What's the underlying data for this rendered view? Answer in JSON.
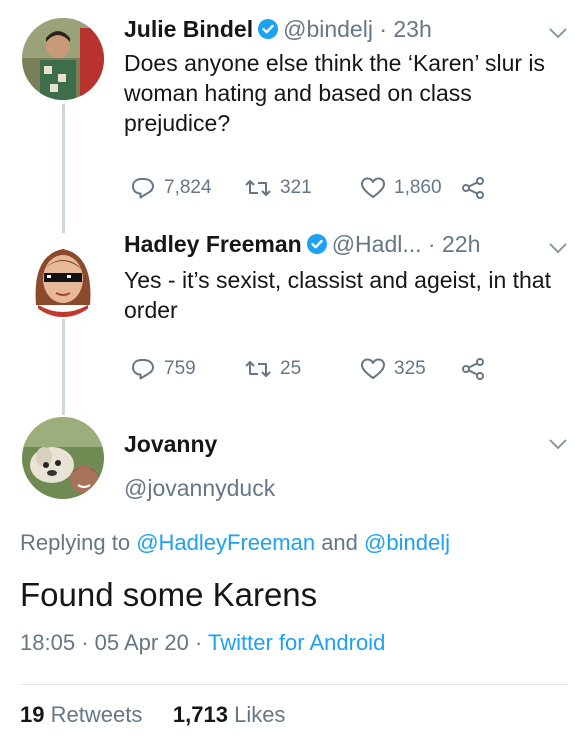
{
  "tweets": [
    {
      "name": "Julie Bindel",
      "handle": "@bindelj",
      "dot": "·",
      "time": "23h",
      "text": "Does anyone else think the ‘Karen’ slur  is woman hating and based on class prejudice?",
      "replies": "7,824",
      "retweets": "321",
      "likes": "1,860"
    },
    {
      "name": "Hadley Freeman",
      "handle": "@Hadl...",
      "dot": "·",
      "time": "22h",
      "text": "Yes - it’s sexist, classist and ageist, in that order",
      "replies": "759",
      "retweets": "25",
      "likes": "325"
    }
  ],
  "main": {
    "name": "Jovanny",
    "handle": "@jovannyduck",
    "replying_prefix": "Replying to",
    "mention1": "@HadleyFreeman",
    "and": "and",
    "mention2": "@bindelj",
    "text": "Found some Karens",
    "time": "18:05",
    "dot": "·",
    "date": "05 Apr 20",
    "source": "Twitter for Android",
    "retweet_count": "19",
    "retweet_label": "Retweets",
    "like_count": "1,713",
    "like_label": "Likes"
  },
  "icons": {
    "verified": "verified-badge-icon",
    "chevron": "chevron-down-icon",
    "reply": "reply-icon",
    "retweet": "retweet-icon",
    "like": "heart-icon",
    "share": "share-icon"
  },
  "colors": {
    "verified": "#1da1f2",
    "link": "#1da1f2",
    "muted": "#657786",
    "text": "#14171a"
  }
}
